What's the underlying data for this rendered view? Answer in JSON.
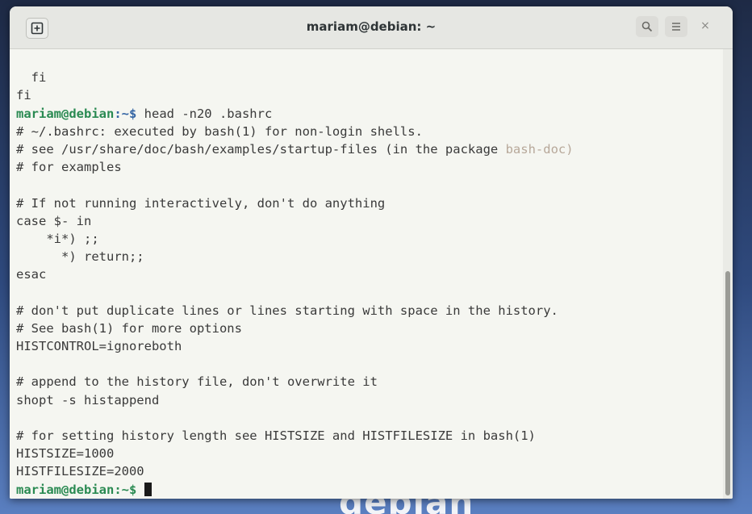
{
  "window": {
    "title": "mariam@debian: ~",
    "new_tab_icon": "new-tab-icon",
    "search_icon": "search-icon",
    "menu_icon": "hamburger-menu-icon",
    "close_label": "×"
  },
  "wallpaper": {
    "brand_text": "debian"
  },
  "terminal": {
    "prompt_user": "mariam@debian",
    "prompt_path": ":~$ ",
    "command": "head -n20 .bashrc",
    "pre_lines": [
      "  fi",
      "fi"
    ],
    "output_lines": [
      "# ~/.bashrc: executed by bash(1) for non-login shells.",
      "# see /usr/share/doc/bash/examples/startup-files (in the package ",
      "# for examples",
      "",
      "# If not running interactively, don't do anything",
      "case $- in",
      "    *i*) ;;",
      "      *) return;;",
      "esac",
      "",
      "# don't put duplicate lines or lines starting with space in the history.",
      "# See bash(1) for more options",
      "HISTCONTROL=ignoreboth",
      "",
      "# append to the history file, don't overwrite it",
      "shopt -s histappend",
      "",
      "# for setting history length see HISTSIZE and HISTFILESIZE in bash(1)",
      "HISTSIZE=1000",
      "HISTFILESIZE=2000"
    ],
    "package_suffix": "bash-doc)",
    "final_prompt": "mariam@debian:~$ "
  },
  "colors": {
    "prompt_user": "#2a8a52",
    "prompt_path": "#3465a4",
    "terminal_bg": "#f5f6f1"
  }
}
